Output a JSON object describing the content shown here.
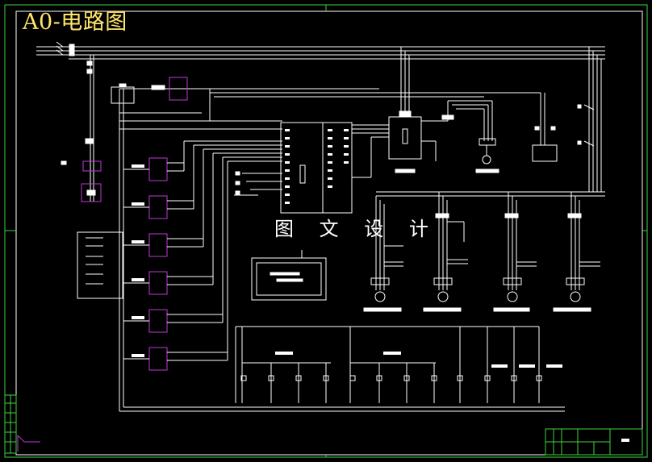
{
  "drawing": {
    "title": "A0-电路图",
    "watermark": "图 文 设 计",
    "colors": {
      "background": "#000000",
      "line": "#ffffff",
      "frame_green": "#3fd23f",
      "component_magenta": "#c03ad6",
      "title_yellow": "#ffe66b",
      "accent_cyan": "#41e0e0"
    }
  }
}
